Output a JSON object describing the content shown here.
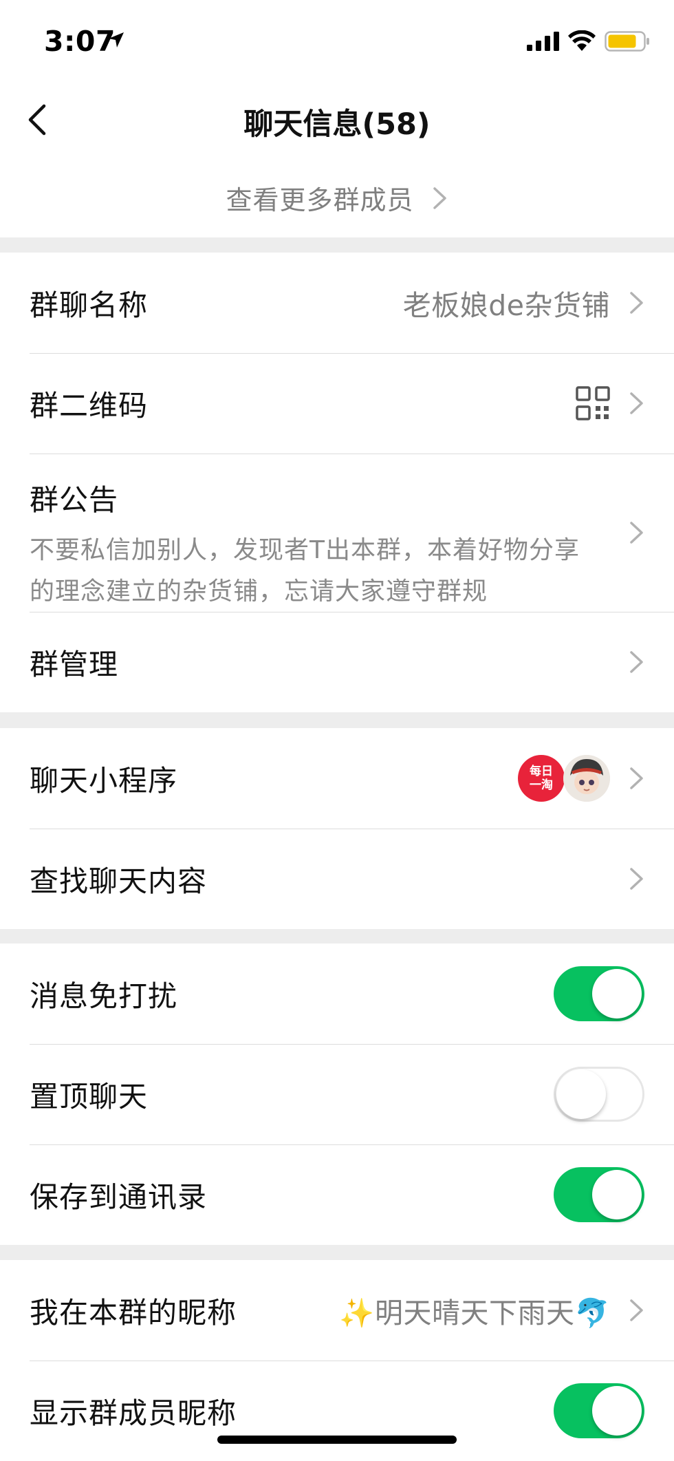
{
  "status_bar": {
    "time": "3:07",
    "battery_color": "#f5c400"
  },
  "nav": {
    "title": "聊天信息(58)",
    "more_members": "查看更多群成员"
  },
  "info_group": {
    "group_name_label": "群聊名称",
    "group_name_value": "老板娘de杂货铺",
    "qr_label": "群二维码",
    "announcement_label": "群公告",
    "announcement_text": "不要私信加别人，发现者T出本群，本着好物分享的理念建立的杂货铺，忘请大家遵守群规",
    "manage_label": "群管理"
  },
  "tools_group": {
    "mini_programs_label": "聊天小程序",
    "mini_app_1_text": "每日一淘",
    "search_label": "查找聊天内容"
  },
  "settings_group": {
    "mute_label": "消息免打扰",
    "mute_on": true,
    "pin_label": "置顶聊天",
    "pin_on": false,
    "save_label": "保存到通讯录",
    "save_on": true
  },
  "profile_group": {
    "nickname_label": "我在本群的昵称",
    "nickname_value": "✨明天晴天下雨天🐬",
    "show_nicknames_label": "显示群成员昵称",
    "show_nicknames_on": true
  },
  "colors": {
    "accent": "#07c160",
    "background": "#ededed"
  }
}
